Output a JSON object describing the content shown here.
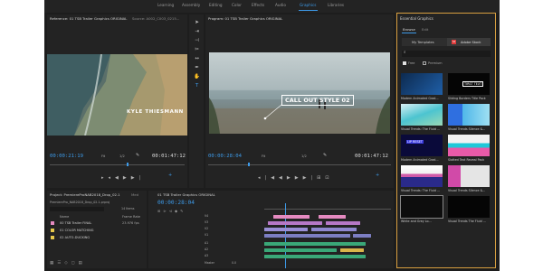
{
  "workspace_tabs": [
    {
      "label": "Learning",
      "active": false
    },
    {
      "label": "Assembly",
      "active": false
    },
    {
      "label": "Editing",
      "active": false
    },
    {
      "label": "Color",
      "active": false
    },
    {
      "label": "Effects",
      "active": false
    },
    {
      "label": "Audio",
      "active": false
    },
    {
      "label": "Graphics",
      "active": true
    },
    {
      "label": "Libraries",
      "active": false
    }
  ],
  "source_panel": {
    "tab_reference": "Reference: 01 TSB Trailer Graphics ORIGINAL",
    "tab_source": "Source: A002_C003_0215...",
    "overlay_text": "KYLE THIESMANN",
    "timecode_left": "00:00:21:19",
    "fit_label": "Fit",
    "resolution_label": "1/2",
    "timecode_right": "00:01:47:12"
  },
  "program_panel": {
    "tab": "Program: 01 TSB Trailer Graphics ORIGINAL",
    "callout_text": "CALL OUT STYLE 02",
    "timecode_left": "00:00:28:04",
    "fit_label": "Fit",
    "resolution_label": "1/2",
    "timecode_right": "00:01:47:12"
  },
  "project_panel": {
    "tab": "Project: PremiereProNAB2018_Drop_02.1",
    "tab_media": "Med",
    "file": "PremierePro_NAB2018_Drop_02.1.prproj",
    "count": "14 Items",
    "col_name": "Name",
    "col_rate": "Frame Rate",
    "items": [
      {
        "name": "00 TSB Trailer FINAL",
        "rate": "23.976 fps",
        "color": "#e58ac0"
      },
      {
        "name": "01 COLOR MATCHING",
        "rate": "",
        "color": "#e6c84b"
      },
      {
        "name": "02 AUTO-DUCKING",
        "rate": "",
        "color": "#e6c84b"
      }
    ]
  },
  "timeline_panel": {
    "tab": "01 TSB Trailer Graphics ORIGINAL",
    "timecode": "00:00:28:04",
    "tracks": [
      "V4",
      "V3",
      "V2",
      "V1",
      "A1",
      "A2",
      "A3",
      "Master"
    ],
    "master_value": "0.0"
  },
  "essential_graphics": {
    "title": "Essential Graphics",
    "tab_browse": "Browse",
    "tab_edit": "Edit",
    "my_templates": "My Templates",
    "adobe_stock": "Adobe Stock",
    "search_placeholder": "",
    "filter_free": "Free",
    "filter_premium": "Premium",
    "templates": [
      {
        "label": "Modern Animated Grad...",
        "thumb_text": ""
      },
      {
        "label": "Sliding Borders Title Pack",
        "thumb_text": "TIRST TEXT"
      },
      {
        "label": "Visual Trends: The Fluid ...",
        "thumb_text": ""
      },
      {
        "label": "Visual Trends Silence &...",
        "thumb_text": ""
      },
      {
        "label": "Modern Animated Grad...",
        "thumb_text": "LIP RESET"
      },
      {
        "label": "Slotted Text Reveal Pack",
        "thumb_text": ""
      },
      {
        "label": "Visual Trends: The Fluid ...",
        "thumb_text": ""
      },
      {
        "label": "Visual Trends Silence &...",
        "thumb_text": ""
      },
      {
        "label": "White and Grey Lo...",
        "thumb_text": ""
      },
      {
        "label": "Visual Trends The Fluid ...",
        "thumb_text": ""
      }
    ]
  },
  "colors": {
    "accent": "#3d9ae8",
    "panel_highlight": "#d9a040",
    "background": "#1d1d1d"
  }
}
